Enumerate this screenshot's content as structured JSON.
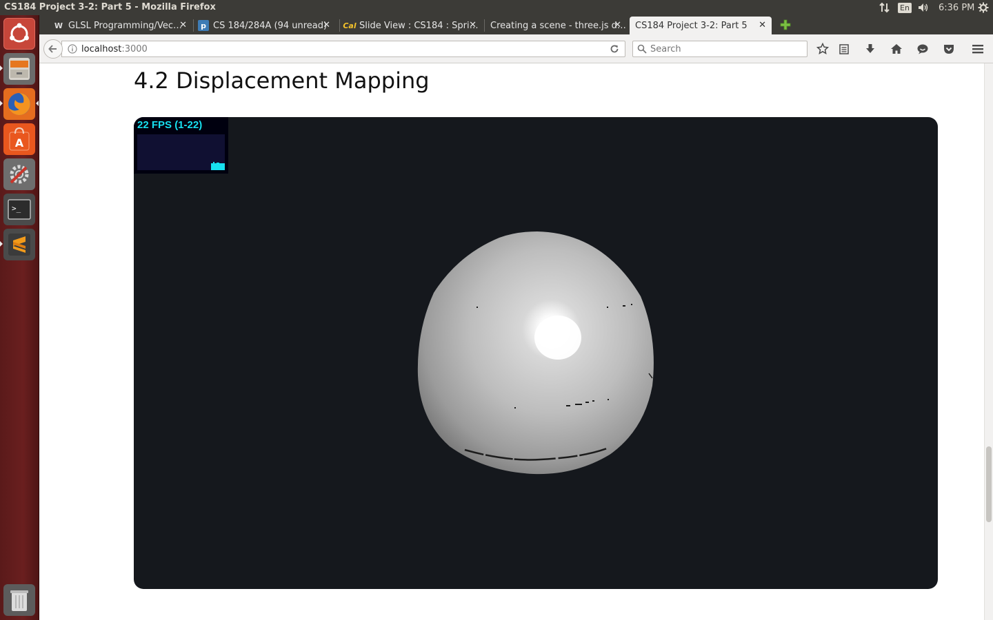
{
  "system_panel": {
    "window_title": "CS184 Project 3-2: Part 5 - Mozilla Firefox",
    "keyboard_layout": "En",
    "clock": "6:36 PM"
  },
  "launcher": {
    "items": [
      {
        "name": "dash-home",
        "icon": "ubuntu-logo-icon"
      },
      {
        "name": "files",
        "icon": "file-cabinet-icon"
      },
      {
        "name": "firefox",
        "icon": "firefox-icon"
      },
      {
        "name": "software-center",
        "icon": "shopping-bag-icon"
      },
      {
        "name": "system-settings",
        "icon": "wrench-gear-icon"
      },
      {
        "name": "terminal",
        "icon": "terminal-icon"
      },
      {
        "name": "sublime-text",
        "icon": "sublime-icon"
      },
      {
        "name": "trash",
        "icon": "trash-icon"
      }
    ]
  },
  "tabs": [
    {
      "label": "GLSL Programming/Vec…",
      "favicon": "wiki-icon",
      "active": false
    },
    {
      "label": "CS 184/284A (94 unread)",
      "favicon": "piazza-icon",
      "active": false
    },
    {
      "label": "Slide View : CS184 : Spri…",
      "favicon": "cal-icon",
      "active": false
    },
    {
      "label": "Creating a scene - three.js d…",
      "favicon": "none",
      "active": false
    },
    {
      "label": "CS184 Project 3-2: Part 5",
      "favicon": "none",
      "active": true
    }
  ],
  "navbar": {
    "url_host": "localhost",
    "url_port": ":3000",
    "search_placeholder": "Search"
  },
  "page": {
    "heading": "4.2 Displacement Mapping",
    "fps_label": "22 FPS (1-22)"
  },
  "colors": {
    "canvas_bg": "#15181d",
    "fps_text": "#17e0ef",
    "fps_panel_bg": "#00000f",
    "launcher_bg": "#6a1f1f"
  }
}
